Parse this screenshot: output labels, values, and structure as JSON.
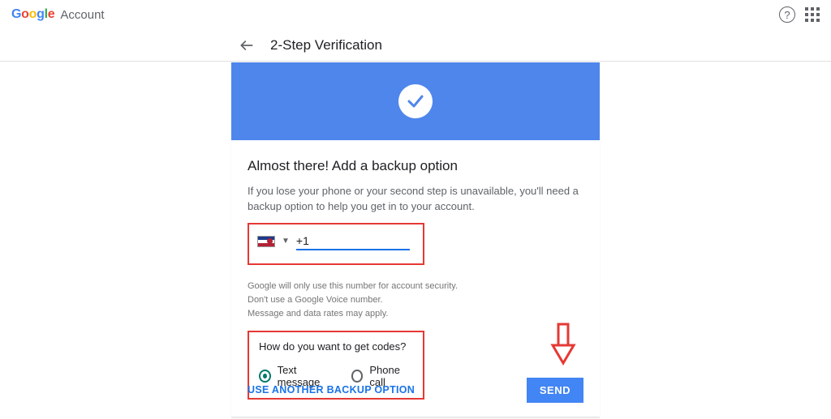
{
  "brand": {
    "sub": "Account"
  },
  "crumb": {
    "title": "2-Step Verification"
  },
  "card": {
    "headline": "Almost there! Add a backup option",
    "desc": "If you lose your phone or your second step is unavailable, you'll need a backup option to help you get in to your account.",
    "phone": {
      "value": "+1"
    },
    "hint1": "Google will only use this number for account security.",
    "hint2": "Don't use a Google Voice number.",
    "hint3": "Message and data rates may apply.",
    "codes_q": "How do you want to get codes?",
    "radio_text": "Text message",
    "radio_call": "Phone call",
    "alt_link": "USE ANOTHER BACKUP OPTION",
    "send": "SEND"
  }
}
